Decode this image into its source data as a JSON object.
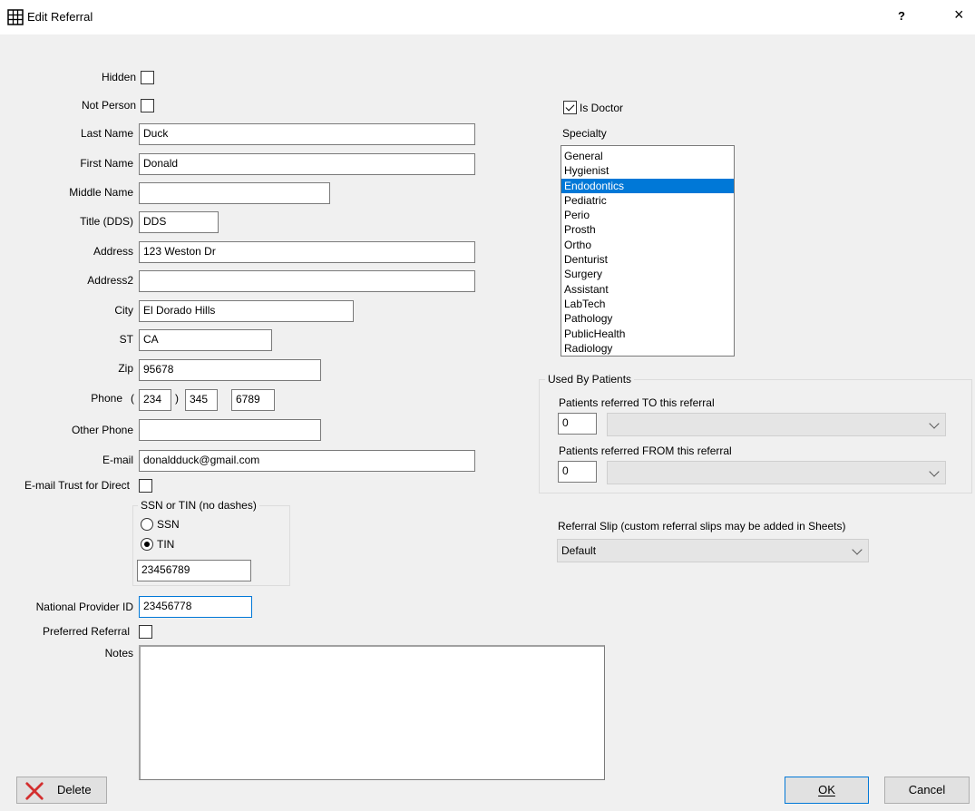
{
  "window": {
    "title": "Edit Referral",
    "help": "?",
    "close": "×"
  },
  "fields": {
    "hidden": {
      "label": "Hidden",
      "checked": false
    },
    "not_person": {
      "label": "Not Person",
      "checked": false
    },
    "last_name": {
      "label": "Last Name",
      "value": "Duck"
    },
    "first_name": {
      "label": "First Name",
      "value": "Donald"
    },
    "middle_name": {
      "label": "Middle Name",
      "value": ""
    },
    "title": {
      "label": "Title (DDS)",
      "value": "DDS"
    },
    "address": {
      "label": "Address",
      "value": "123 Weston Dr"
    },
    "address2": {
      "label": "Address2",
      "value": ""
    },
    "city": {
      "label": "City",
      "value": "El Dorado Hills"
    },
    "st": {
      "label": "ST",
      "value": "CA"
    },
    "zip": {
      "label": "Zip",
      "value": "95678"
    },
    "phone": {
      "label": "Phone",
      "open": "(",
      "close": ")",
      "area": "234",
      "prefix": "345",
      "line": "6789"
    },
    "other_phone": {
      "label": "Other Phone",
      "value": ""
    },
    "email": {
      "label": "E-mail",
      "value": "donaldduck@gmail.com"
    },
    "email_trust": {
      "label": "E-mail Trust for Direct",
      "checked": false
    },
    "npi": {
      "label": "National Provider ID",
      "value": "23456778"
    },
    "preferred": {
      "label": "Preferred Referral",
      "checked": false
    },
    "notes": {
      "label": "Notes",
      "value": ""
    }
  },
  "ssn_group": {
    "title": "SSN or TIN (no dashes)",
    "ssn_label": "SSN",
    "tin_label": "TIN",
    "selected": "TIN",
    "value": "23456789"
  },
  "doctor": {
    "is_doctor_label": "Is Doctor",
    "checked": true
  },
  "specialty": {
    "label": "Specialty",
    "items": [
      "General",
      "Hygienist",
      "Endodontics",
      "Pediatric",
      "Perio",
      "Prosth",
      "Ortho",
      "Denturist",
      "Surgery",
      "Assistant",
      "LabTech",
      "Pathology",
      "PublicHealth",
      "Radiology"
    ],
    "selected": "Endodontics"
  },
  "used_by": {
    "title": "Used By Patients",
    "to_label": "Patients referred TO this referral",
    "to_count": "0",
    "from_label": "Patients referred FROM this referral",
    "from_count": "0"
  },
  "referral_slip": {
    "label": "Referral Slip (custom referral slips may be added in Sheets)",
    "value": "Default"
  },
  "buttons": {
    "delete": "Delete",
    "ok": "OK",
    "cancel": "Cancel"
  },
  "colors": {
    "accent": "#0078d7",
    "delete_icon": "#d32f2f"
  }
}
